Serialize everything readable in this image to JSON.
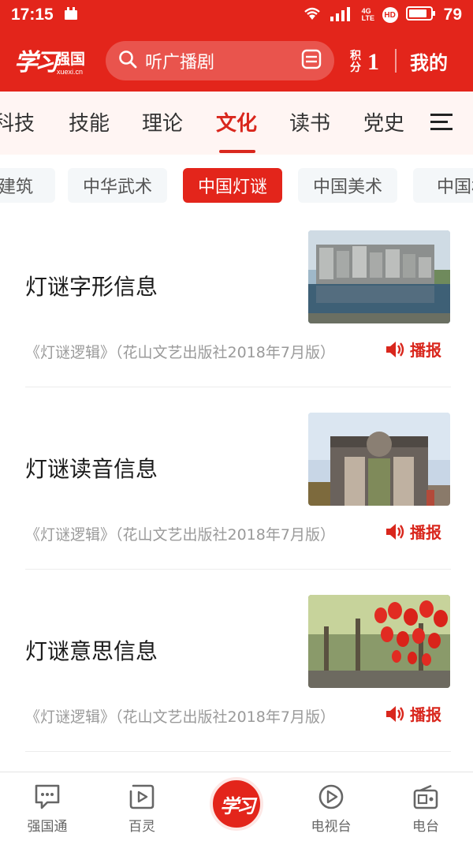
{
  "status_bar": {
    "time": "17:15",
    "network_tag": "4G LTE",
    "hd_tag": "HD",
    "battery": "79"
  },
  "header": {
    "logo_script": "学习",
    "logo_text": "强国",
    "logo_domain": "xuexi.cn",
    "search_placeholder": "听广播剧",
    "points_label": "积分",
    "points_value": "1",
    "my_label": "我的"
  },
  "category_tabs": [
    {
      "label": "科技",
      "active": false
    },
    {
      "label": "技能",
      "active": false
    },
    {
      "label": "理论",
      "active": false
    },
    {
      "label": "文化",
      "active": true
    },
    {
      "label": "读书",
      "active": false
    },
    {
      "label": "党史",
      "active": false
    }
  ],
  "sub_chips": [
    {
      "label": "建筑",
      "active": false
    },
    {
      "label": "中华武术",
      "active": false
    },
    {
      "label": "中国灯谜",
      "active": true
    },
    {
      "label": "中国美术",
      "active": false
    },
    {
      "label": "中国格",
      "active": false
    }
  ],
  "articles": [
    {
      "title": "灯谜字形信息",
      "source": "《灯谜逻辑》（花山文艺出版社2018年7月版）",
      "action": "播报",
      "thumb": "sculpture-wall-reflection-photo"
    },
    {
      "title": "灯谜读音信息",
      "source": "《灯谜逻辑》（花山文艺出版社2018年7月版）",
      "action": "播报",
      "thumb": "stone-gate-archway-photo"
    },
    {
      "title": "灯谜意思信息",
      "source": "《灯谜逻辑》（花山文艺出版社2018年7月版）",
      "action": "播报",
      "thumb": "red-lanterns-street-photo"
    }
  ],
  "bottom_nav": [
    {
      "label": "强国通",
      "icon": "chat-bubble-icon"
    },
    {
      "label": "百灵",
      "icon": "play-square-icon"
    },
    {
      "label": "学习",
      "icon": "home-logo-icon"
    },
    {
      "label": "电视台",
      "icon": "play-circle-icon"
    },
    {
      "label": "电台",
      "icon": "radio-icon"
    }
  ],
  "colors": {
    "brand_red": "#e3251b",
    "active_red": "#d9271d"
  }
}
